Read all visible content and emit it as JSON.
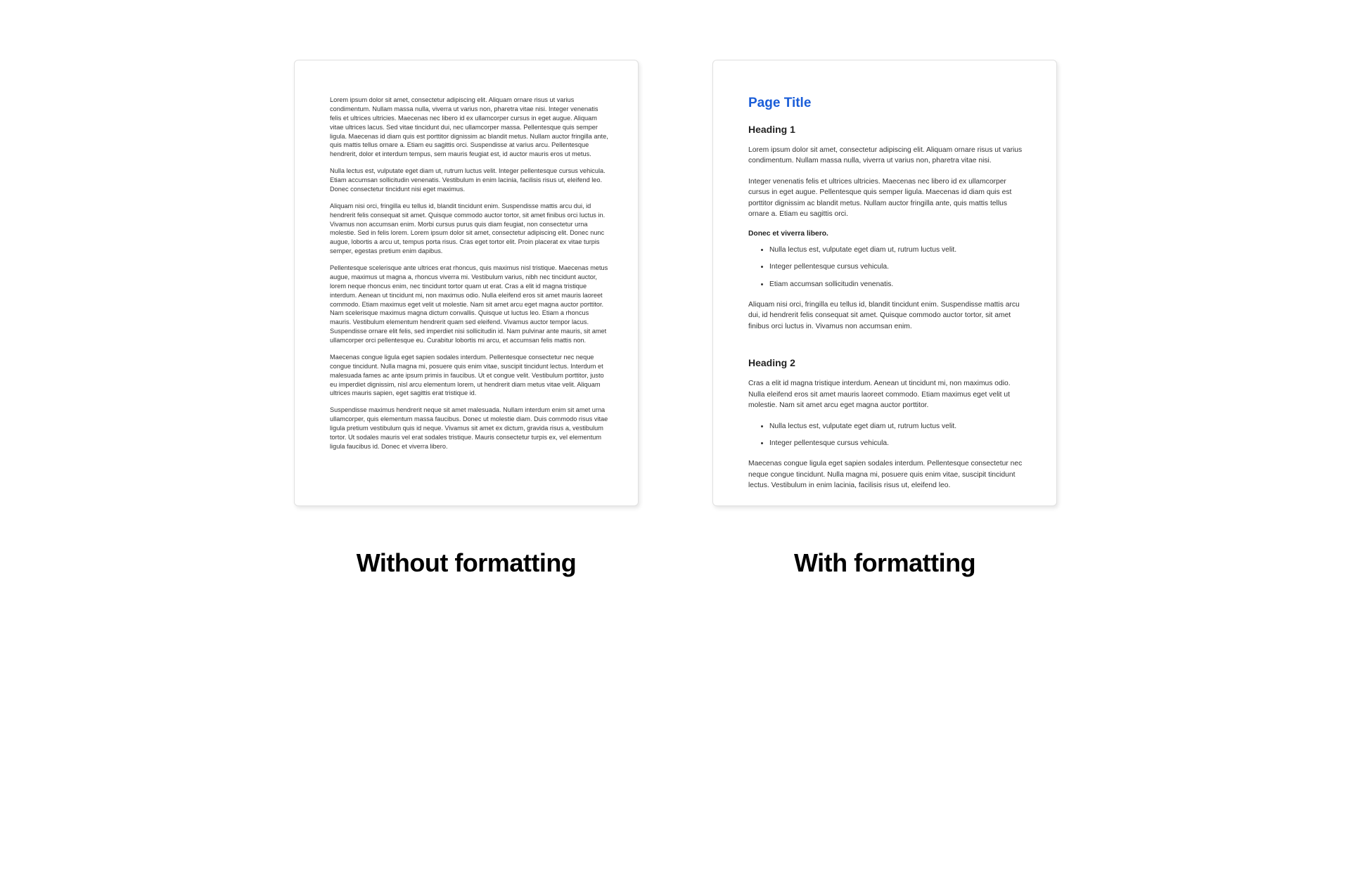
{
  "left": {
    "p1": "Lorem ipsum dolor sit amet, consectetur adipiscing elit. Aliquam ornare risus ut varius condimentum. Nullam massa nulla, viverra ut varius non, pharetra vitae nisi. Integer venenatis felis et ultrices ultricies. Maecenas nec libero id ex ullamcorper cursus in eget augue. Aliquam vitae ultrices lacus. Sed vitae tincidunt dui, nec ullamcorper massa. Pellentesque quis semper ligula. Maecenas id diam quis est porttitor dignissim ac blandit metus. Nullam auctor fringilla ante, quis mattis tellus ornare a. Etiam eu sagittis orci. Suspendisse at varius arcu. Pellentesque hendrerit, dolor et interdum tempus, sem mauris feugiat est, id auctor mauris eros ut metus.",
    "p2": "Nulla lectus est, vulputate eget diam ut, rutrum luctus velit. Integer pellentesque cursus vehicula. Etiam accumsan sollicitudin venenatis. Vestibulum in enim lacinia, facilisis risus ut, eleifend leo. Donec consectetur tincidunt nisi eget maximus.",
    "p3": "Aliquam nisi orci, fringilla eu tellus id, blandit tincidunt enim. Suspendisse mattis arcu dui, id hendrerit felis consequat sit amet. Quisque commodo auctor tortor, sit amet finibus orci luctus in. Vivamus non accumsan enim. Morbi cursus purus quis diam feugiat, non consectetur urna molestie. Sed in felis lorem. Lorem ipsum dolor sit amet, consectetur adipiscing elit. Donec nunc augue, lobortis a arcu ut, tempus porta risus. Cras eget tortor elit. Proin placerat ex vitae turpis semper, egestas pretium enim dapibus.",
    "p4": "Pellentesque scelerisque ante ultrices erat rhoncus, quis maximus nisl tristique. Maecenas metus augue, maximus ut magna a, rhoncus viverra mi. Vestibulum varius, nibh nec tincidunt auctor, lorem neque rhoncus enim, nec tincidunt tortor quam ut erat. Cras a elit id magna tristique interdum. Aenean ut tincidunt mi, non maximus odio. Nulla eleifend eros sit amet mauris laoreet commodo. Etiam maximus eget velit ut molestie. Nam sit amet arcu eget magna auctor porttitor. Nam scelerisque maximus magna dictum convallis. Quisque ut luctus leo. Etiam a rhoncus mauris. Vestibulum elementum hendrerit quam sed eleifend. Vivamus auctor tempor lacus. Suspendisse ornare elit felis, sed imperdiet nisi sollicitudin id. Nam pulvinar ante mauris, sit amet ullamcorper orci pellentesque eu. Curabitur lobortis mi arcu, et accumsan felis mattis non.",
    "p5": "Maecenas congue ligula eget sapien sodales interdum. Pellentesque consectetur nec neque congue tincidunt. Nulla magna mi, posuere quis enim vitae, suscipit tincidunt lectus. Interdum et malesuada fames ac ante ipsum primis in faucibus. Ut et congue velit. Vestibulum porttitor, justo eu imperdiet dignissim, nisl arcu elementum lorem, ut hendrerit diam metus vitae velit. Aliquam ultrices mauris sapien, eget sagittis erat tristique id.",
    "p6": "Suspendisse maximus hendrerit neque sit amet malesuada. Nullam interdum enim sit amet urna ullamcorper, quis elementum massa faucibus. Donec ut molestie diam. Duis commodo risus vitae ligula pretium vestibulum quis id neque. Vivamus sit amet ex dictum, gravida risus a, vestibulum tortor. Ut sodales mauris vel erat sodales tristique. Mauris consectetur turpis ex, vel elementum ligula faucibus id. Donec et viverra libero."
  },
  "right": {
    "page_title": "Page Title",
    "heading1": "Heading 1",
    "p1": "Lorem ipsum dolor sit amet, consectetur adipiscing elit. Aliquam ornare risus ut varius condimentum. Nullam massa nulla, viverra ut varius non, pharetra vitae nisi.",
    "p2": "Integer venenatis felis et ultrices ultricies. Maecenas nec libero id ex ullamcorper cursus in eget augue. Pellentesque quis semper ligula. Maecenas id diam quis est porttitor dignissim ac blandit metus.  Nullam auctor fringilla ante, quis mattis tellus ornare a. Etiam eu sagittis orci.",
    "bold_line": "Donec et viverra libero.",
    "list1": {
      "i1": "Nulla lectus est, vulputate eget diam ut, rutrum luctus velit.",
      "i2": "Integer pellentesque cursus vehicula.",
      "i3": "Etiam accumsan sollicitudin venenatis."
    },
    "p3": "Aliquam nisi orci, fringilla eu tellus id, blandit tincidunt enim. Suspendisse mattis arcu dui, id hendrerit felis consequat sit amet. Quisque commodo auctor tortor, sit amet finibus orci luctus in. Vivamus non accumsan enim.",
    "heading2": "Heading 2",
    "p4": "Cras a elit id magna tristique interdum. Aenean ut tincidunt mi, non maximus odio. Nulla eleifend eros sit amet mauris laoreet commodo. Etiam maximus eget velit ut molestie. Nam sit amet arcu eget magna auctor porttitor.",
    "list2": {
      "i1": "Nulla lectus est, vulputate eget diam ut, rutrum luctus velit.",
      "i2": "Integer pellentesque cursus vehicula."
    },
    "p5": "Maecenas congue ligula eget sapien sodales interdum. Pellentesque consectetur nec neque congue tincidunt. Nulla magna mi, posuere quis enim vitae, suscipit tincidunt lectus. Vestibulum in enim lacinia, facilisis risus ut, eleifend leo."
  },
  "captions": {
    "left": "Without formatting",
    "right": "With formatting"
  }
}
